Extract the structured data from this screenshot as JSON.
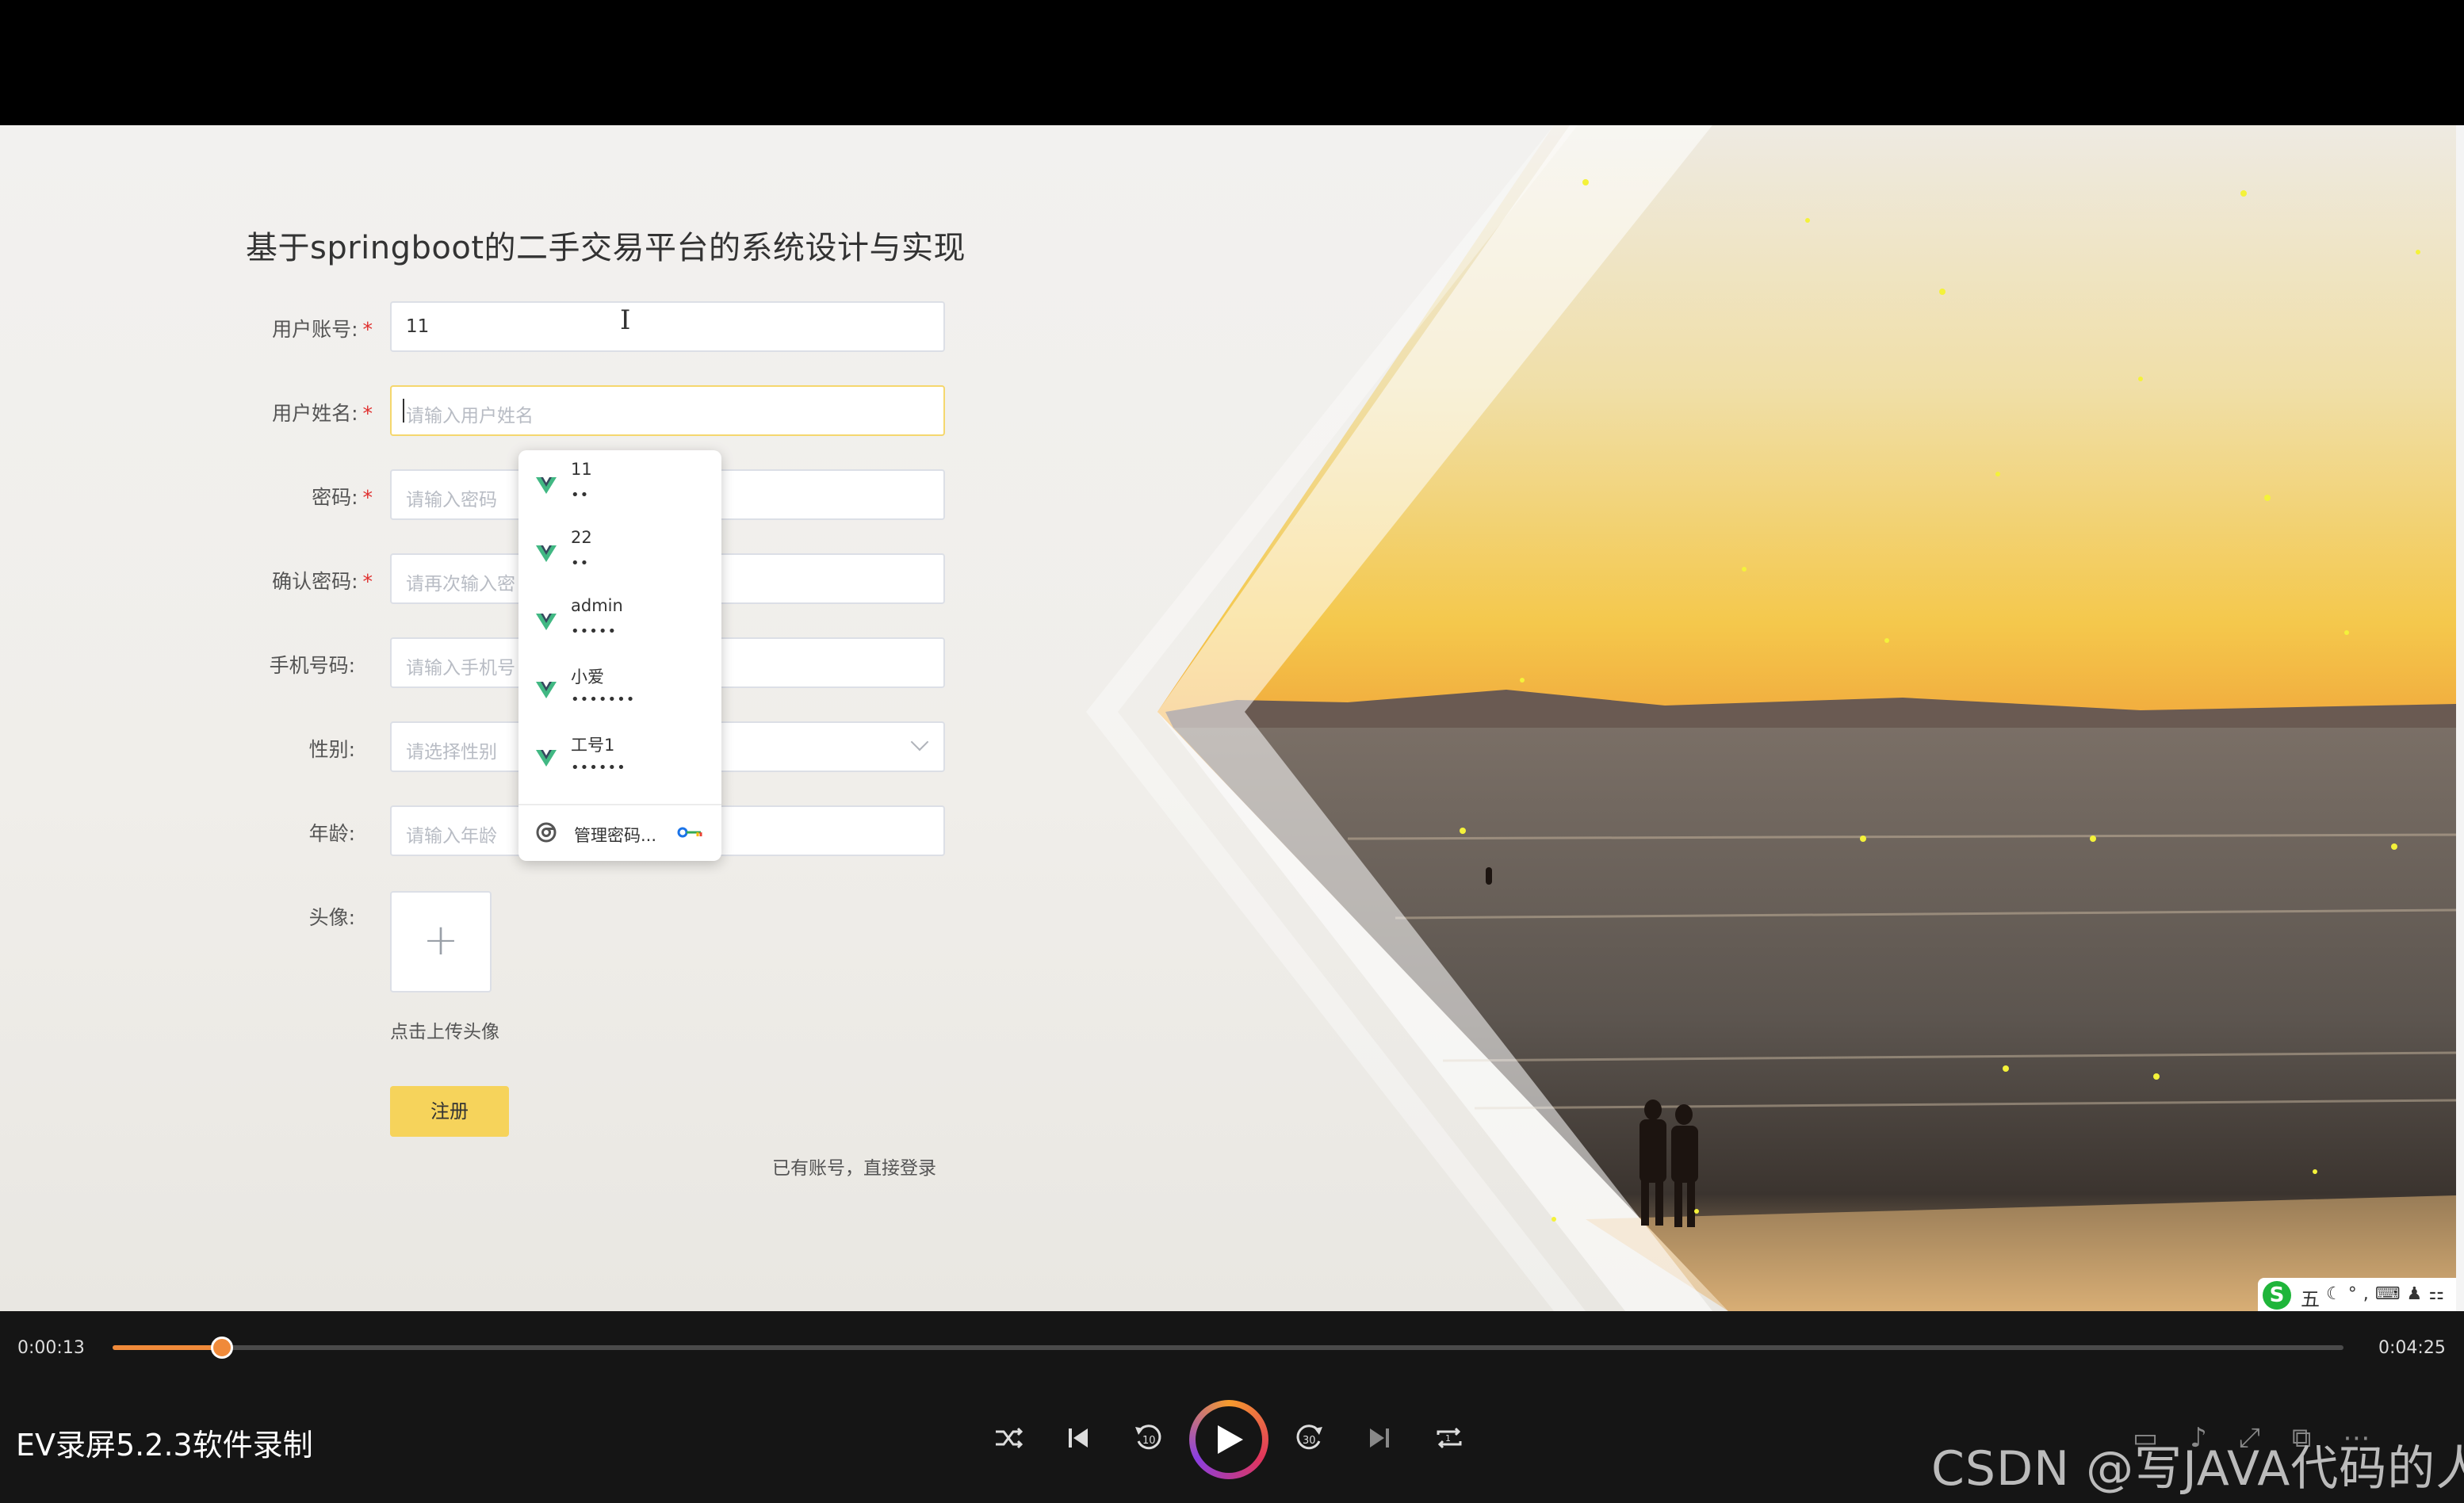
{
  "form": {
    "title": "基于springboot的二手交易平台的系统设计与实现",
    "fields": [
      {
        "label": "用户账号:",
        "required": true,
        "value": "11",
        "placeholder": ""
      },
      {
        "label": "用户姓名:",
        "required": true,
        "value": "",
        "placeholder": "请输入用户姓名"
      },
      {
        "label": "密码:",
        "required": true,
        "value": "",
        "placeholder": "请输入密码"
      },
      {
        "label": "确认密码:",
        "required": true,
        "value": "",
        "placeholder": "请再次输入密"
      },
      {
        "label": "手机号码:",
        "required": false,
        "value": "",
        "placeholder": "请输入手机号"
      },
      {
        "label": "性别:",
        "required": false,
        "value": "",
        "placeholder": "请选择性别"
      },
      {
        "label": "年龄:",
        "required": false,
        "value": "",
        "placeholder": "请输入年龄"
      }
    ],
    "avatar_label": "头像:",
    "avatar_plus": "+",
    "upload_tip": "点击上传头像",
    "register_label": "注册",
    "login_link": "已有账号，直接登录",
    "required_mark": "*"
  },
  "autofill": {
    "items": [
      {
        "user": "11",
        "pass": "••"
      },
      {
        "user": "22",
        "pass": "••"
      },
      {
        "user": "admin",
        "pass": "•••••"
      },
      {
        "user": "小爱",
        "pass": "•••••••"
      },
      {
        "user": "工号1",
        "pass": "••••••"
      }
    ],
    "manage_label": "管理密码...",
    "icons": {
      "entry": "vue-logo-icon",
      "manage": "chrome-icon",
      "key": "key-icon"
    },
    "colors": {
      "vue_green": "#41b883",
      "vue_dark": "#35495e"
    }
  },
  "ime": {
    "logo": "S",
    "mode": "五",
    "icons": "☾°,⌨♟⚏"
  },
  "player": {
    "current_time": "0:00:13",
    "total_time": "0:04:25",
    "progress": 0.049,
    "recorder_name": "EV录屏5.2.3软件录制",
    "watermark": "CSDN @写JAVA代码的人",
    "accent": "#f08a3a",
    "controls": [
      "shuffle-icon",
      "previous-icon",
      "rewind-10-icon",
      "play-icon",
      "forward-30-icon",
      "next-icon",
      "loop-icon"
    ]
  }
}
